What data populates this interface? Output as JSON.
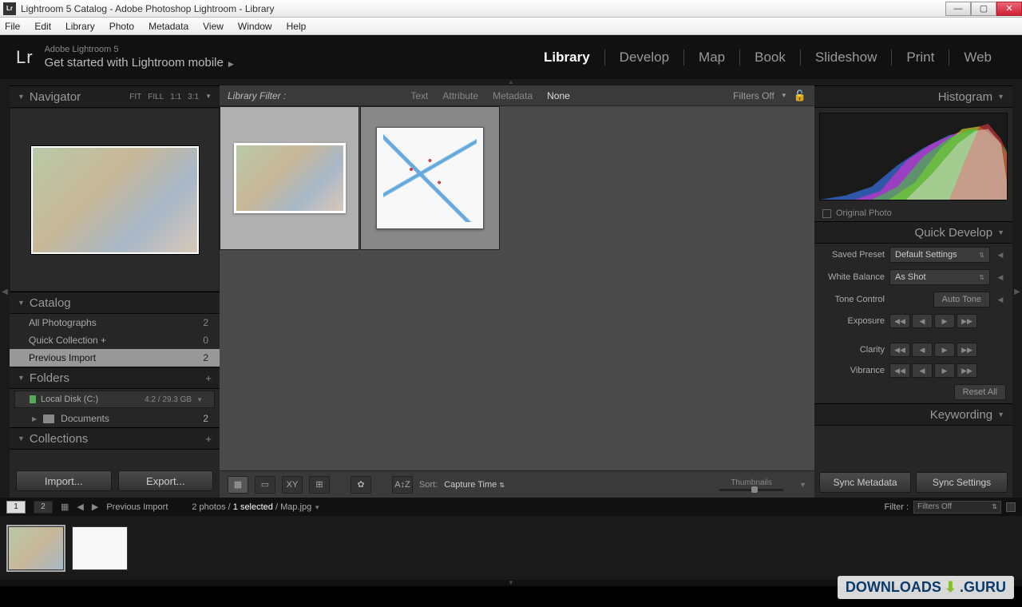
{
  "window": {
    "title": "Lightroom 5 Catalog - Adobe Photoshop Lightroom - Library",
    "app_icon": "Lr"
  },
  "menubar": [
    "File",
    "Edit",
    "Library",
    "Photo",
    "Metadata",
    "View",
    "Window",
    "Help"
  ],
  "header": {
    "logo": "Lr",
    "subtitle": "Adobe Lightroom 5",
    "mobile": "Get started with Lightroom mobile",
    "modules": [
      "Library",
      "Develop",
      "Map",
      "Book",
      "Slideshow",
      "Print",
      "Web"
    ],
    "active_module": "Library"
  },
  "left": {
    "navigator": {
      "title": "Navigator",
      "zoom": [
        "FIT",
        "FILL",
        "1:1",
        "3:1"
      ]
    },
    "catalog": {
      "title": "Catalog",
      "items": [
        {
          "label": "All Photographs",
          "count": "2"
        },
        {
          "label": "Quick Collection  +",
          "count": "0"
        },
        {
          "label": "Previous Import",
          "count": "2",
          "selected": true
        }
      ]
    },
    "folders": {
      "title": "Folders",
      "disk": {
        "label": "Local Disk (C:)",
        "size": "4.2 / 29.3 GB"
      },
      "docs": {
        "label": "Documents",
        "count": "2"
      }
    },
    "collections": {
      "title": "Collections"
    },
    "import_btn": "Import...",
    "export_btn": "Export..."
  },
  "filter": {
    "label": "Library Filter :",
    "tabs": [
      "Text",
      "Attribute",
      "Metadata",
      "None"
    ],
    "active": "None",
    "filters_off": "Filters Off"
  },
  "toolbar": {
    "sort_label": "Sort:",
    "sort_value": "Capture Time",
    "thumbnails": "Thumbnails"
  },
  "right": {
    "histogram": {
      "title": "Histogram",
      "original": "Original Photo"
    },
    "quickdev": {
      "title": "Quick Develop",
      "saved_preset": {
        "label": "Saved Preset",
        "value": "Default Settings"
      },
      "white_balance": {
        "label": "White Balance",
        "value": "As Shot"
      },
      "tone_control": {
        "label": "Tone Control",
        "auto": "Auto Tone"
      },
      "exposure": "Exposure",
      "clarity": "Clarity",
      "vibrance": "Vibrance",
      "reset": "Reset All"
    },
    "keywording": {
      "title": "Keywording"
    },
    "sync_meta": "Sync Metadata",
    "sync_settings": "Sync Settings"
  },
  "status": {
    "pages": [
      "1",
      "2"
    ],
    "source": "Previous Import",
    "count": "2 photos /",
    "selected": "1 selected",
    "file": " / Map.jpg",
    "filter_label": "Filter :",
    "filter_value": "Filters Off"
  },
  "watermark": {
    "downloads": "DOWNLOADS",
    "guru": ".GURU"
  }
}
